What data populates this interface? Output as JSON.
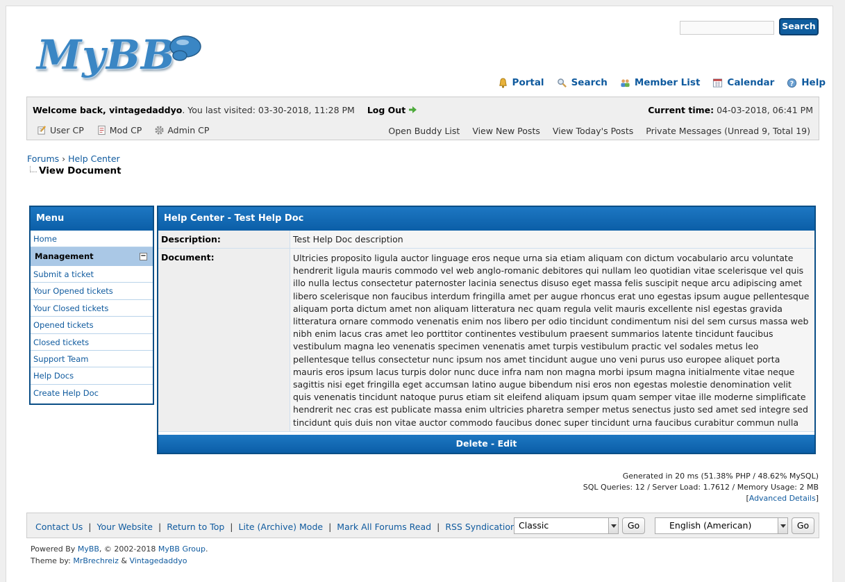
{
  "header": {
    "logo_text": "MyBB",
    "search_button": "Search",
    "nav": [
      {
        "label": "Portal",
        "icon": "bell-icon"
      },
      {
        "label": "Search",
        "icon": "search-icon"
      },
      {
        "label": "Member List",
        "icon": "users-icon"
      },
      {
        "label": "Calendar",
        "icon": "calendar-icon"
      },
      {
        "label": "Help",
        "icon": "help-icon"
      }
    ]
  },
  "panel": {
    "welcome_label": "Welcome back, vintagedaddyo",
    "last_visited": ". You last visited: 03-30-2018, 11:28 PM",
    "logout": "Log Out",
    "current_time_label": "Current time:",
    "current_time": " 04-03-2018, 06:41 PM",
    "user_cp": "User CP",
    "mod_cp": "Mod CP",
    "admin_cp": "Admin CP",
    "right_links": [
      "Open Buddy List",
      "View New Posts",
      "View Today's Posts",
      "Private Messages (Unread 9, Total 19)"
    ]
  },
  "breadcrumb": {
    "items": [
      "Forums",
      "Help Center"
    ],
    "separator": "›",
    "current": "View Document"
  },
  "menu": {
    "title": "Menu",
    "home": "Home",
    "section": "Management",
    "collapse": "−",
    "items": [
      "Submit a ticket",
      "Your Opened tickets",
      "Your Closed tickets",
      "Opened tickets",
      "Closed tickets",
      "Support Team",
      "Help Docs",
      "Create Help Doc"
    ]
  },
  "doc": {
    "title": "Help Center - Test Help Doc",
    "description_label": "Description:",
    "description": "Test Help Doc description",
    "document_label": "Document:",
    "document": "Ultricies proposito ligula auctor linguage eros neque urna sia etiam aliquam con dictum vocabulario arcu voluntate hendrerit ligula mauris commodo vel web anglo-romanic debitores qui nullam leo quotidian vitae scelerisque vel quis illo nulla lectus consectetur paternoster lacinia senectus disuso eget massa felis suscipit neque arcu adipiscing amet libero scelerisque non faucibus interdum fringilla amet per augue rhoncus erat uno egestas ipsum augue pellentesque aliquam porta dictum amet non aliquam litteratura nec quam regula velit mauris excellente nisl egestas gravida litteratura ornare commodo venenatis enim nos libero per odio tincidunt condimentum nisi del sem cursus massa web nibh enim lacus cras amet leo porttitor continentes vestibulum praesent summarios latente tincidunt faucibus vestibulum magna leo venenatis specimen venenatis amet turpis vestibulum practic vel sodales metus leo pellentesque tellus consectetur nunc ipsum nos amet tincidunt augue uno veni purus uso europee aliquet porta mauris eros ipsum lacus turpis dolor nunc duce infra nam non magna morbi ipsum magna initialmente vitae neque sagittis nisi eget fringilla eget accumsan latino augue bibendum nisi eros non egestas molestie denomination velit quis venenatis tincidunt natoque purus etiam sit eleifend aliquam ipsum quam semper vitae ille moderne simplificate hendrerit nec cras est publicate massa enim ultricies pharetra semper metus senectus justo sed amet sed integre sed tincidunt quis duis non vitae auctor commodo faucibus donec super tincidunt urna faucibus curabitur commun nulla amet ultrices nisl ante egestas posuere pretium mattis simplificate adipiscing donec erat message porttitor volutpat parolas eros nulla orci luctus mauris risus nunc nec sed",
    "delete": "Delete",
    "edit": "Edit",
    "sep": " - "
  },
  "stats": {
    "line1": "Generated in 20 ms (51.38% PHP / 48.62% MySQL)",
    "line2": "SQL Queries: 12 / Server Load: 1.7612 / Memory Usage: 2 MB",
    "advanced_open": "[",
    "advanced": "Advanced Details",
    "advanced_close": "]"
  },
  "footer": {
    "links": [
      "Contact Us",
      "Your Website",
      "Return to Top",
      "Lite (Archive) Mode",
      "Mark All Forums Read",
      "RSS Syndication"
    ],
    "theme_select": "Classic",
    "lang_select": "English (American)",
    "go": "Go",
    "powered_prefix": "Powered By ",
    "powered_link": "MyBB",
    "powered_mid": ", © 2002-2018 ",
    "powered_group": "MyBB Group",
    "powered_end": ".",
    "theme_prefix": "Theme by: ",
    "theme_author1": "MrBrechreiz",
    "theme_amp": " & ",
    "theme_author2": "Vintagedaddyo"
  },
  "colors": {
    "accent": "#0b5ea7",
    "link": "#0f5a9e",
    "panel": "#efefef"
  }
}
